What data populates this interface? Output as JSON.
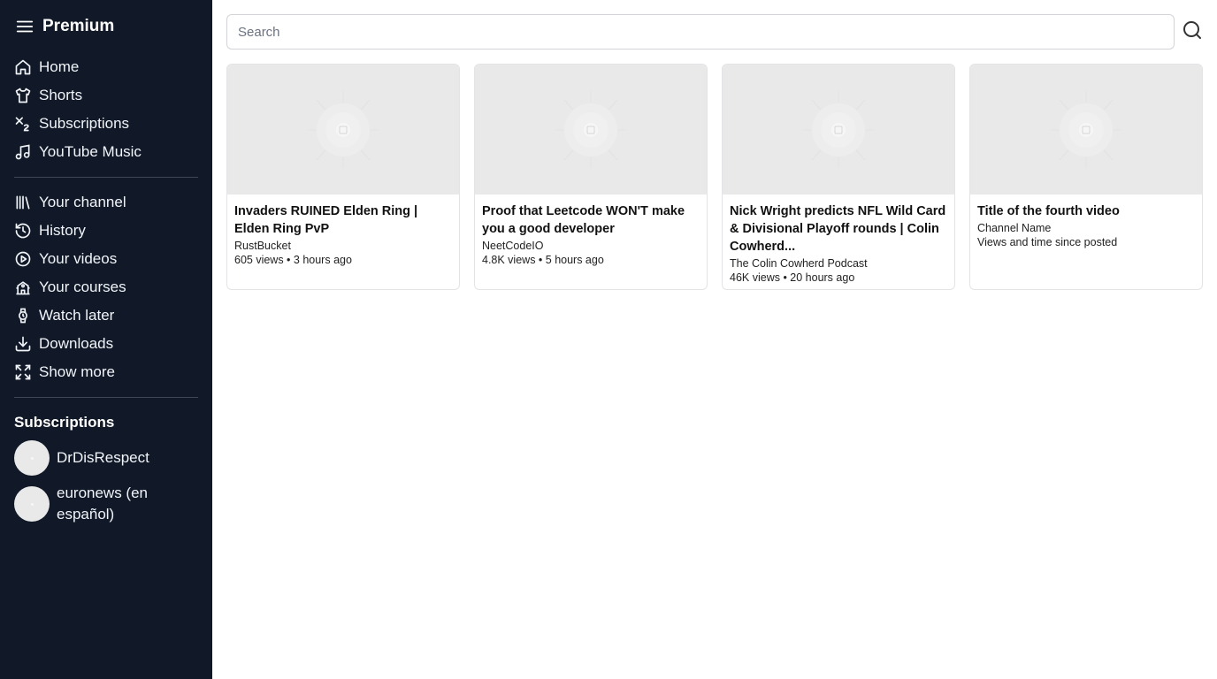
{
  "sidebar": {
    "brand": "Premium",
    "primary": [
      {
        "label": "Home",
        "icon": "home-icon"
      },
      {
        "label": "Shorts",
        "icon": "shirt-icon"
      },
      {
        "label": "Subscriptions",
        "icon": "subscript-icon"
      },
      {
        "label": "YouTube Music",
        "icon": "music-icon"
      }
    ],
    "secondary": [
      {
        "label": "Your channel",
        "icon": "library-icon"
      },
      {
        "label": "History",
        "icon": "history-icon"
      },
      {
        "label": "Your videos",
        "icon": "play-circle-icon"
      },
      {
        "label": "Your courses",
        "icon": "school-icon"
      },
      {
        "label": "Watch later",
        "icon": "watch-icon"
      },
      {
        "label": "Downloads",
        "icon": "download-icon"
      },
      {
        "label": "Show more",
        "icon": "expand-icon"
      }
    ],
    "subscriptions_heading": "Subscriptions",
    "subscriptions": [
      {
        "name": "DrDisRespect"
      },
      {
        "name": "euronews (en español)"
      }
    ]
  },
  "search": {
    "placeholder": "Search",
    "value": ""
  },
  "videos": [
    {
      "title": "Invaders RUINED Elden Ring | Elden Ring PvP",
      "channel": "RustBucket",
      "meta": "605 views • 3 hours ago"
    },
    {
      "title": "Proof that Leetcode WON'T make you a good developer",
      "channel": "NeetCodeIO",
      "meta": "4.8K views • 5 hours ago"
    },
    {
      "title": "Nick Wright predicts NFL Wild Card & Divisional Playoff rounds | Colin Cowherd...",
      "channel": "The Colin Cowherd Podcast",
      "meta": "46K views • 20 hours ago"
    },
    {
      "title": "Title of the fourth video",
      "channel": "Channel Name",
      "meta": "Views and time since posted"
    }
  ],
  "colors": {
    "sidebar_bg": "#111827",
    "thumbnail_placeholder": "#e9e9e9"
  }
}
